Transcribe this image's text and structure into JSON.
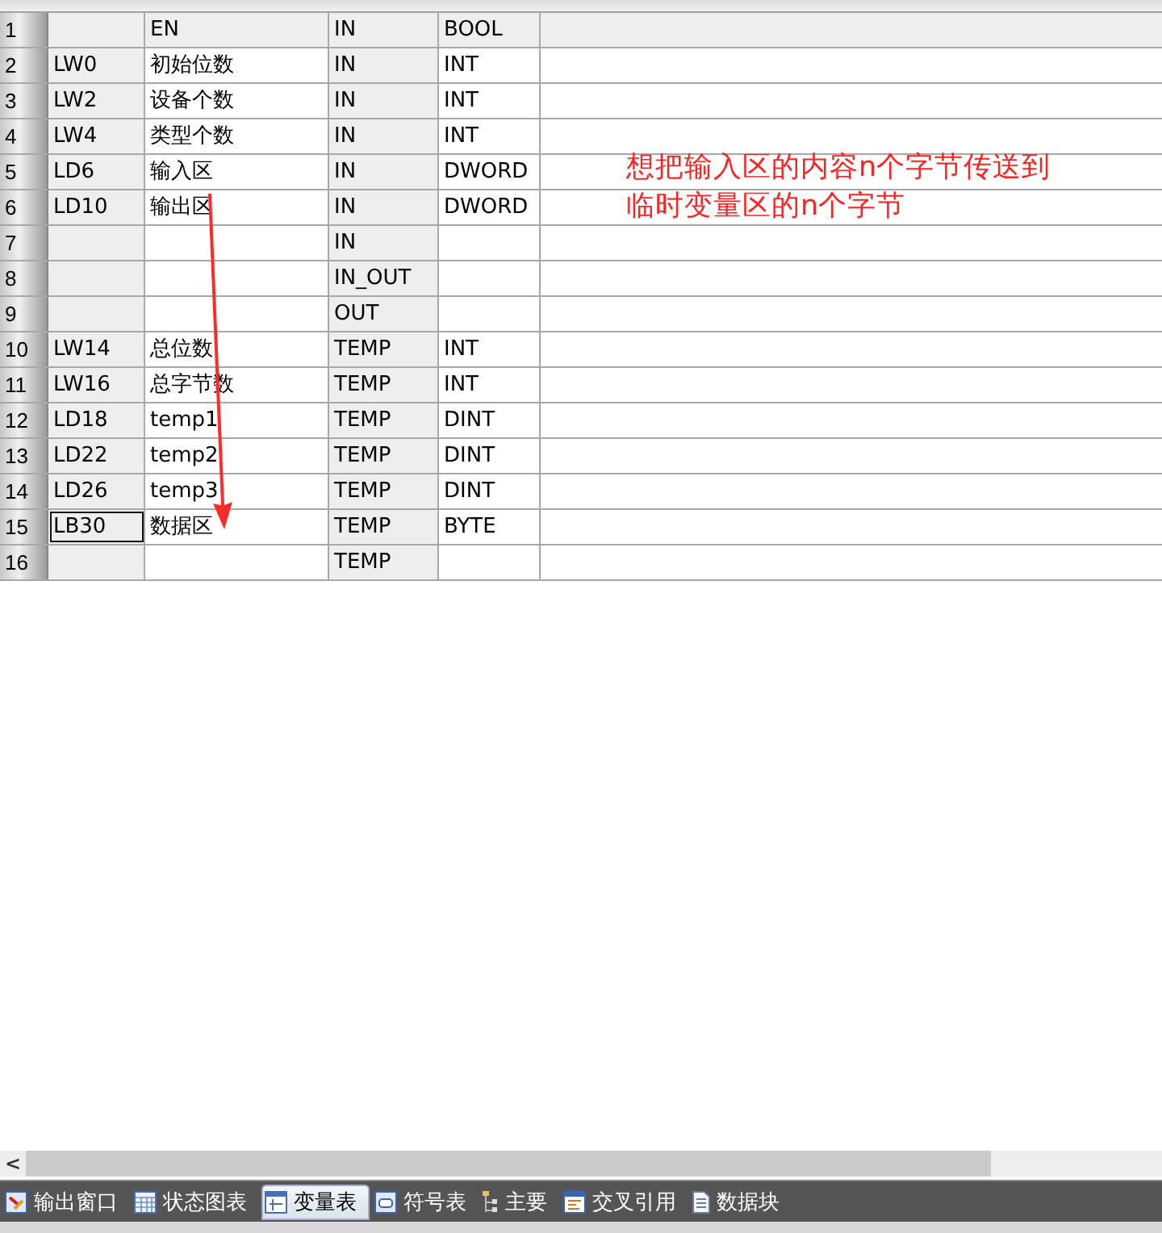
{
  "table": {
    "rows": [
      {
        "number": "1",
        "address": "",
        "symbol": "EN",
        "var_type": "IN",
        "data_type": "BOOL",
        "fixed": true,
        "selected": false
      },
      {
        "number": "2",
        "address": "LW0",
        "symbol": "初始位数",
        "var_type": "IN",
        "data_type": "INT",
        "fixed": false,
        "selected": false
      },
      {
        "number": "3",
        "address": "LW2",
        "symbol": "设备个数",
        "var_type": "IN",
        "data_type": "INT",
        "fixed": false,
        "selected": false
      },
      {
        "number": "4",
        "address": "LW4",
        "symbol": "类型个数",
        "var_type": "IN",
        "data_type": "INT",
        "fixed": false,
        "selected": false
      },
      {
        "number": "5",
        "address": "LD6",
        "symbol": "输入区",
        "var_type": "IN",
        "data_type": "DWORD",
        "fixed": false,
        "selected": false
      },
      {
        "number": "6",
        "address": "LD10",
        "symbol": "输出区",
        "var_type": "IN",
        "data_type": "DWORD",
        "fixed": false,
        "selected": false
      },
      {
        "number": "7",
        "address": "",
        "symbol": "",
        "var_type": "IN",
        "data_type": "",
        "fixed": false,
        "selected": false
      },
      {
        "number": "8",
        "address": "",
        "symbol": "",
        "var_type": "IN_OUT",
        "data_type": "",
        "fixed": false,
        "selected": false
      },
      {
        "number": "9",
        "address": "",
        "symbol": "",
        "var_type": "OUT",
        "data_type": "",
        "fixed": false,
        "selected": false
      },
      {
        "number": "10",
        "address": "LW14",
        "symbol": "总位数",
        "var_type": "TEMP",
        "data_type": "INT",
        "fixed": false,
        "selected": false
      },
      {
        "number": "11",
        "address": "LW16",
        "symbol": "总字节数",
        "var_type": "TEMP",
        "data_type": "INT",
        "fixed": false,
        "selected": false
      },
      {
        "number": "12",
        "address": "LD18",
        "symbol": "temp1",
        "var_type": "TEMP",
        "data_type": "DINT",
        "fixed": false,
        "selected": false
      },
      {
        "number": "13",
        "address": "LD22",
        "symbol": "temp2",
        "var_type": "TEMP",
        "data_type": "DINT",
        "fixed": false,
        "selected": false
      },
      {
        "number": "14",
        "address": "LD26",
        "symbol": "temp3",
        "var_type": "TEMP",
        "data_type": "DINT",
        "fixed": false,
        "selected": false
      },
      {
        "number": "15",
        "address": "LB30",
        "symbol": "数据区",
        "var_type": "TEMP",
        "data_type": "BYTE",
        "fixed": false,
        "selected": true
      },
      {
        "number": "16",
        "address": "",
        "symbol": "",
        "var_type": "TEMP",
        "data_type": "",
        "fixed": false,
        "selected": false
      }
    ]
  },
  "annotation": {
    "lines": [
      "想把输入区的内容n个字节传送到",
      "临时变量区的n个字节"
    ]
  },
  "scrollbar": {
    "left_arrow": "<"
  },
  "bottom_tabs": [
    {
      "label": "输出窗口",
      "selected": false
    },
    {
      "label": "状态图表",
      "selected": false
    },
    {
      "label": "变量表",
      "selected": true
    },
    {
      "label": "符号表",
      "selected": false
    },
    {
      "label": "主要",
      "selected": false
    },
    {
      "label": "交叉引用",
      "selected": false
    },
    {
      "label": "数据块",
      "selected": false
    }
  ]
}
